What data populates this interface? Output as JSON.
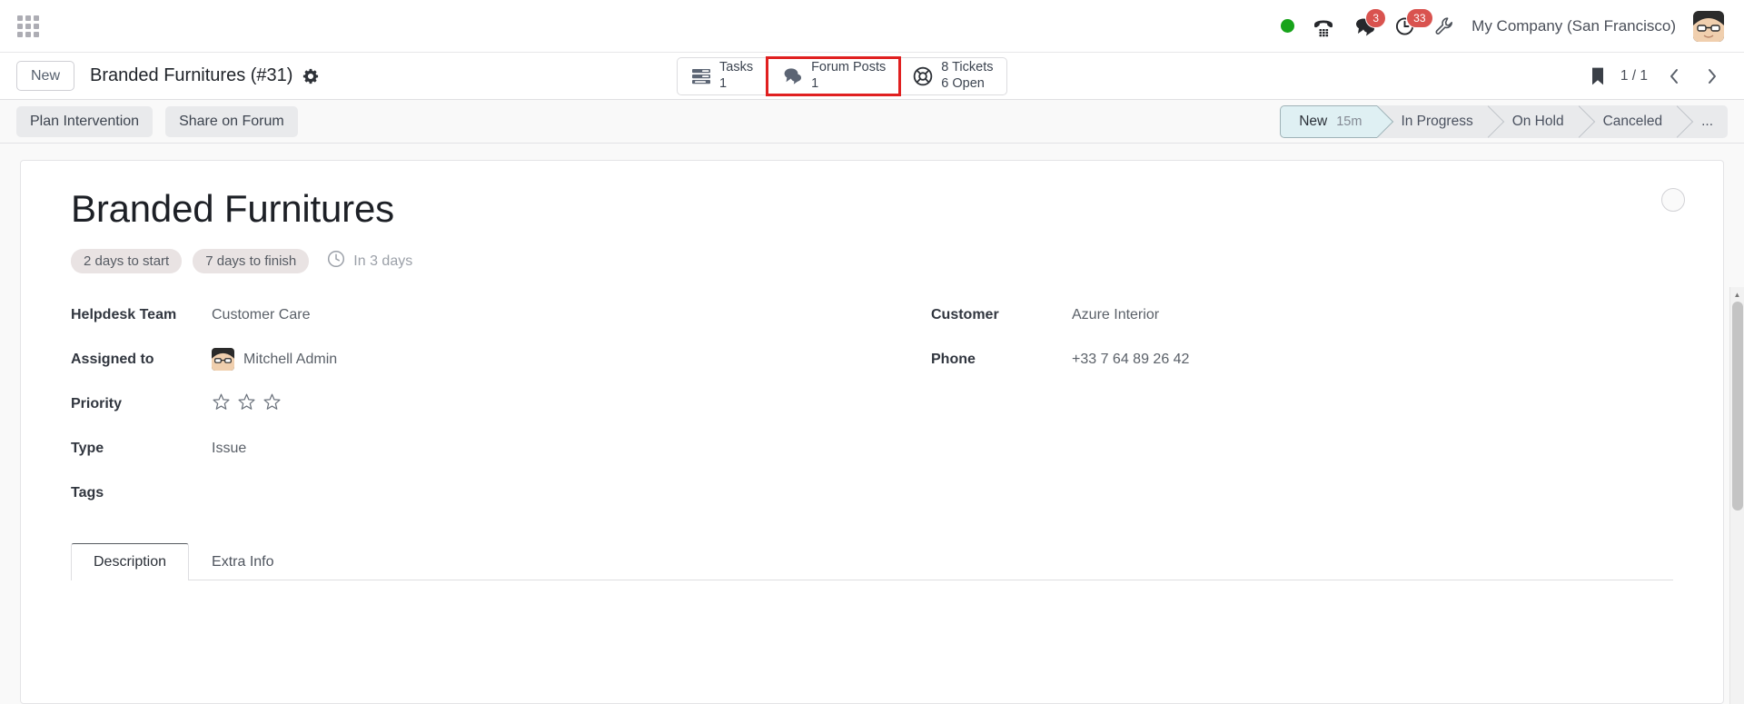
{
  "topbar": {
    "apps_icon": "apps-grid-icon",
    "presence": {
      "icon": "presence-dot-icon",
      "color": "#17a31a"
    },
    "phone": {
      "icon": "phone-icon"
    },
    "messages": {
      "icon": "messages-icon",
      "count": "3"
    },
    "activities": {
      "icon": "clock-activity-icon",
      "count": "33"
    },
    "settings": {
      "icon": "wrench-icon"
    },
    "company": "My Company (San Francisco)",
    "avatar": {
      "icon": "user-avatar-icon"
    }
  },
  "breadcrumb": {
    "new_label": "New",
    "title": "Branded Furnitures (#31)",
    "gear_icon": "gear-icon",
    "bookmark_icon": "bookmark-icon",
    "pager": "1 / 1",
    "prev_icon": "chevron-left-icon",
    "next_icon": "chevron-right-icon"
  },
  "smart_buttons": [
    {
      "icon": "tasks-list-icon",
      "line1": "Tasks",
      "line2": "1",
      "highlighted": false
    },
    {
      "icon": "forum-chat-icon",
      "line1": "Forum Posts",
      "line2": "1",
      "highlighted": true
    },
    {
      "icon": "lifebuoy-ticket-icon",
      "line1": "8 Tickets",
      "line2": "6 Open",
      "highlighted": false
    }
  ],
  "actions": [
    {
      "label": "Plan Intervention"
    },
    {
      "label": "Share on Forum"
    }
  ],
  "statusbar": {
    "stages": [
      {
        "label": "New",
        "time": "15m",
        "active": true
      },
      {
        "label": "In Progress",
        "time": "",
        "active": false
      },
      {
        "label": "On Hold",
        "time": "",
        "active": false
      },
      {
        "label": "Canceled",
        "time": "",
        "active": false
      },
      {
        "label": "...",
        "time": "",
        "active": false
      }
    ]
  },
  "record": {
    "title": "Branded Furnitures",
    "badges": [
      "2 days to start",
      "7 days to finish"
    ],
    "deadline_icon": "clock-icon",
    "deadline_text": "In 3 days",
    "status_circle_icon": "status-circle-icon",
    "fields_left": [
      {
        "label": "Helpdesk Team",
        "value": "Customer Care",
        "type": "text"
      },
      {
        "label": "Assigned to",
        "value": "Mitchell Admin",
        "type": "avatar"
      },
      {
        "label": "Priority",
        "value": "",
        "type": "stars",
        "stars_total": 3,
        "stars_filled": 0
      },
      {
        "label": "Type",
        "value": "Issue",
        "type": "text"
      },
      {
        "label": "Tags",
        "value": "",
        "type": "text"
      }
    ],
    "fields_right": [
      {
        "label": "Customer",
        "value": "Azure Interior",
        "type": "text"
      },
      {
        "label": "Phone",
        "value": "+33 7 64 89 26 42",
        "type": "text"
      }
    ]
  },
  "notebook": {
    "tabs": [
      {
        "label": "Description",
        "active": true
      },
      {
        "label": "Extra Info",
        "active": false
      }
    ]
  }
}
